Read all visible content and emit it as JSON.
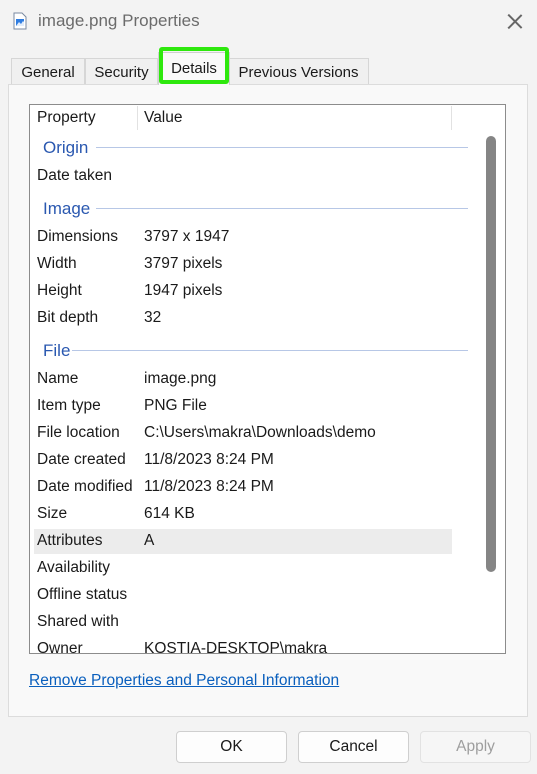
{
  "window": {
    "title": "image.png Properties",
    "icon": "image-file-icon",
    "close_icon": "close-icon"
  },
  "tabs": [
    {
      "label": "General"
    },
    {
      "label": "Security"
    },
    {
      "label": "Details",
      "active": true
    },
    {
      "label": "Previous Versions"
    }
  ],
  "highlight_color": "#2ee80d",
  "details": {
    "headers": {
      "property": "Property",
      "value": "Value"
    },
    "groups": [
      {
        "label": "Origin",
        "rows": [
          {
            "property": "Date taken",
            "value": ""
          }
        ]
      },
      {
        "label": "Image",
        "rows": [
          {
            "property": "Dimensions",
            "value": "3797 x 1947"
          },
          {
            "property": "Width",
            "value": "3797 pixels"
          },
          {
            "property": "Height",
            "value": "1947 pixels"
          },
          {
            "property": "Bit depth",
            "value": "32"
          }
        ]
      },
      {
        "label": "File",
        "rows": [
          {
            "property": "Name",
            "value": "image.png"
          },
          {
            "property": "Item type",
            "value": "PNG File"
          },
          {
            "property": "File location",
            "value": "C:\\Users\\makra\\Downloads\\demo"
          },
          {
            "property": "Date created",
            "value": "11/8/2023 8:24 PM"
          },
          {
            "property": "Date modified",
            "value": "11/8/2023 8:24 PM"
          },
          {
            "property": "Size",
            "value": "614 KB"
          },
          {
            "property": "Attributes",
            "value": "A",
            "selected": true
          },
          {
            "property": "Availability",
            "value": ""
          },
          {
            "property": "Offline status",
            "value": ""
          },
          {
            "property": "Shared with",
            "value": ""
          },
          {
            "property": "Owner",
            "value": "KOSTIA-DESKTOP\\makra"
          }
        ]
      }
    ]
  },
  "remove_link": "Remove Properties and Personal Information",
  "buttons": {
    "ok": "OK",
    "cancel": "Cancel",
    "apply": "Apply"
  }
}
